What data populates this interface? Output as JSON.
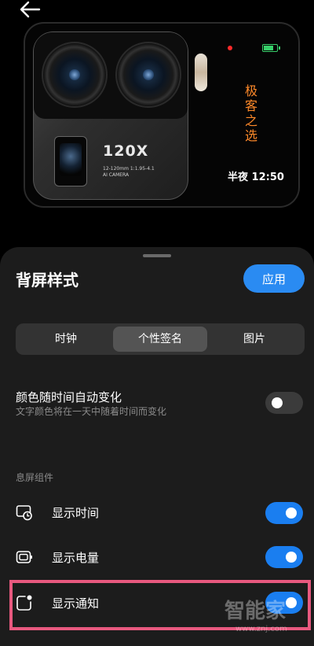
{
  "nav": {
    "back_icon": "arrow-left-icon"
  },
  "preview": {
    "camera_zoom": "120X",
    "camera_spec_line1": "12-120mm  1:1.95-4.1",
    "camera_spec_line2": "AI CAMERA",
    "signature_text": "极客之选",
    "time_text": "半夜 12:50",
    "status_dot_color": "#ff2a2a",
    "battery_color": "#38d16a",
    "signature_color": "#ff8a2a"
  },
  "sheet": {
    "title": "背屏样式",
    "apply_label": "应用",
    "accent_color": "#2a8bf2",
    "tabs": [
      {
        "label": "时钟",
        "active": false
      },
      {
        "label": "个性签名",
        "active": true
      },
      {
        "label": "图片",
        "active": false
      }
    ],
    "color_change": {
      "title": "颜色随时间自动变化",
      "subtitle": "文字颜色将在一天中随着时间而变化",
      "enabled": false
    },
    "widgets_section_label": "息屏组件",
    "widgets": [
      {
        "label": "显示时间",
        "icon": "clock-screen-icon",
        "enabled": true
      },
      {
        "label": "显示电量",
        "icon": "battery-outline-icon",
        "enabled": true
      },
      {
        "label": "显示通知",
        "icon": "notification-dot-icon",
        "enabled": true
      }
    ]
  },
  "watermark": {
    "text": "智能家",
    "url": "www.znj.com"
  }
}
